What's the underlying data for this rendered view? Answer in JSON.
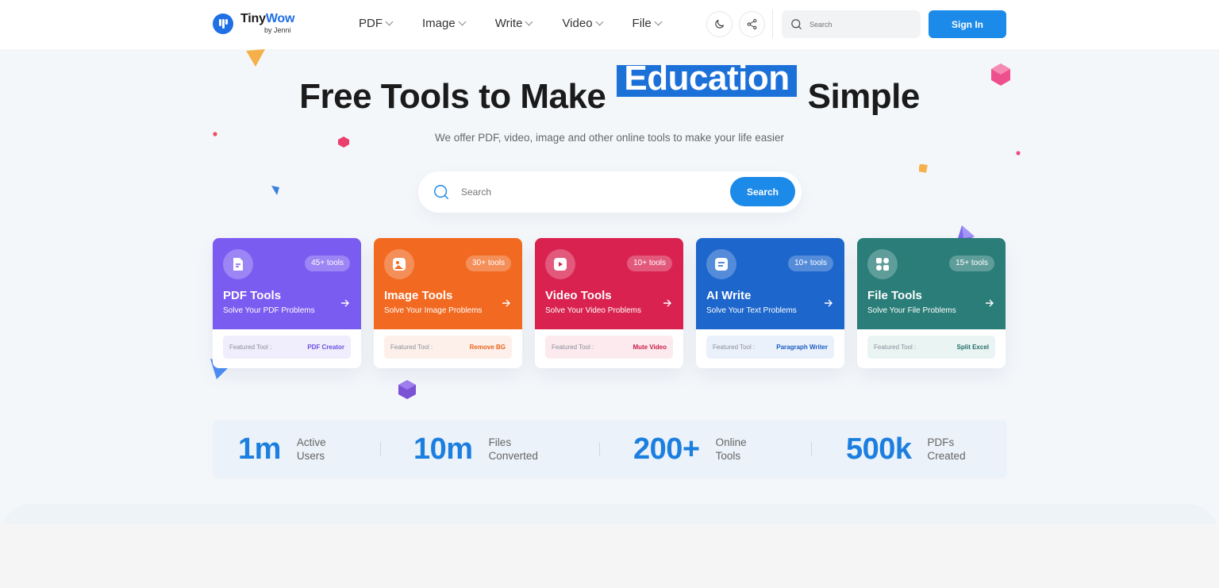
{
  "header": {
    "logo_name_1": "Tiny",
    "logo_name_2": "Wow",
    "logo_by": "by Jenni",
    "nav": [
      "PDF",
      "Image",
      "Write",
      "Video",
      "File"
    ],
    "search_placeholder": "Search",
    "signin_label": "Sign In"
  },
  "hero": {
    "title_before": "Free Tools to Make",
    "title_highlight": "Education",
    "title_after": "Simple",
    "subtitle": "We offer PDF, video, image and other online tools to make your life easier",
    "search_placeholder": "Search",
    "search_button": "Search"
  },
  "cards": [
    {
      "title": "PDF Tools",
      "desc": "Solve Your PDF Problems",
      "badge": "45+ tools",
      "feat_label": "Featured Tool :",
      "feat_value": "PDF Creator",
      "color": "#7b5cf0",
      "feat_bg": "#f0edfd",
      "feat_color": "#6a4fe0",
      "icon": "pdf-icon"
    },
    {
      "title": "Image Tools",
      "desc": "Solve Your Image Problems",
      "badge": "30+ tools",
      "feat_label": "Featured Tool :",
      "feat_value": "Remove BG",
      "color": "#f26a22",
      "feat_bg": "#fdf0ea",
      "feat_color": "#e8621b",
      "icon": "image-icon"
    },
    {
      "title": "Video Tools",
      "desc": "Solve Your Video Problems",
      "badge": "10+ tools",
      "feat_label": "Featured Tool :",
      "feat_value": "Mute Video",
      "color": "#d9224f",
      "feat_bg": "#fceaee",
      "feat_color": "#c81e48",
      "icon": "video-icon"
    },
    {
      "title": "AI Write",
      "desc": "Solve Your Text Problems",
      "badge": "10+ tools",
      "feat_label": "Featured Tool :",
      "feat_value": "Paragraph Writer",
      "color": "#1d66cc",
      "feat_bg": "#eaf1fb",
      "feat_color": "#1a5bbf",
      "icon": "write-icon"
    },
    {
      "title": "File Tools",
      "desc": "Solve Your File Problems",
      "badge": "15+ tools",
      "feat_label": "Featured Tool :",
      "feat_value": "Split Excel",
      "color": "#2a7d78",
      "feat_bg": "#e9f4f3",
      "feat_color": "#236e69",
      "icon": "file-icon"
    }
  ],
  "stats": [
    {
      "num": "1m",
      "label_1": "Active",
      "label_2": "Users"
    },
    {
      "num": "10m",
      "label_1": "Files",
      "label_2": "Converted"
    },
    {
      "num": "200+",
      "label_1": "Online",
      "label_2": "Tools"
    },
    {
      "num": "500k",
      "label_1": "PDFs",
      "label_2": "Created"
    }
  ],
  "colors": {
    "accent": "#1c8ae8",
    "highlight": "#1c71d8",
    "stat": "#1c7fe0"
  }
}
